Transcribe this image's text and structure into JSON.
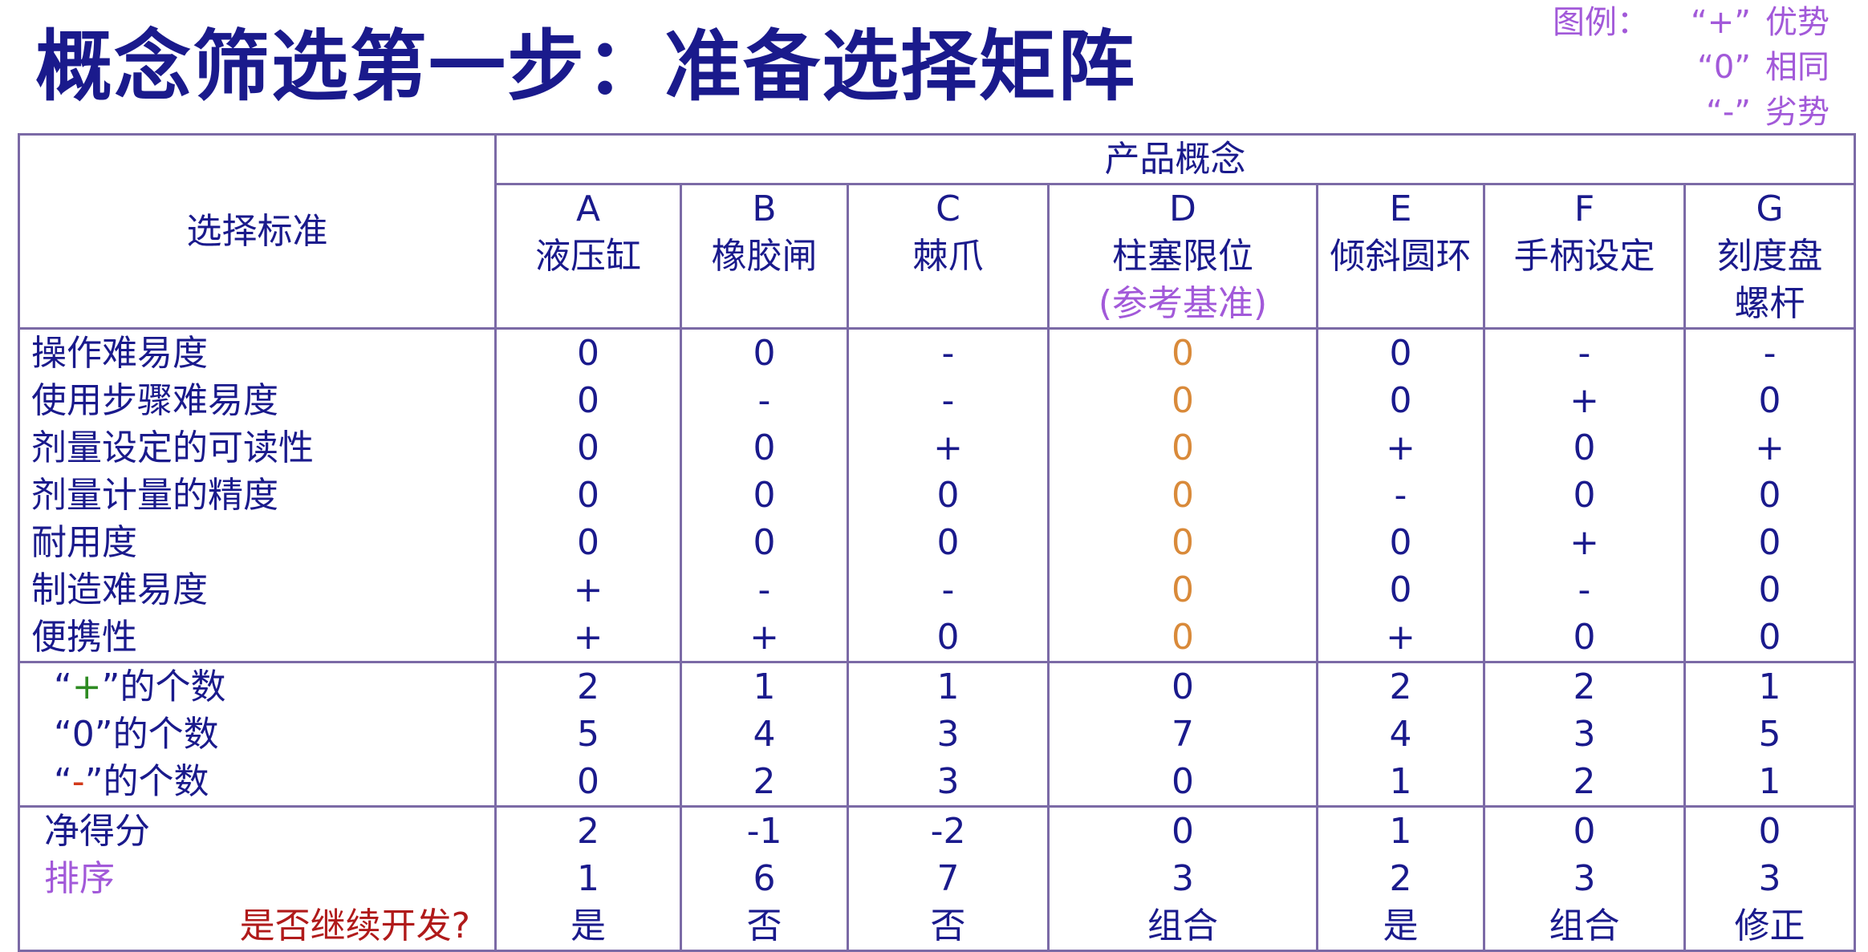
{
  "title": "概念筛选第一步：准备选择矩阵",
  "legend": {
    "label": "图例：",
    "items": [
      {
        "symbol": "“+”",
        "text": "优势"
      },
      {
        "symbol": "“0”",
        "text": "相同"
      },
      {
        "symbol": "“-”",
        "text": "劣势"
      }
    ]
  },
  "colors": {
    "title": "#1a1a8c",
    "border": "#7b6aa6",
    "plus": "#2e8b22",
    "minus": "#d23a1a",
    "reference": "#d98a3a",
    "purple": "#a259d9",
    "red": "#b01a1a"
  },
  "matrix": {
    "criteria_header": "选择标准",
    "group_header": "产品概念",
    "concepts": [
      {
        "letter": "A",
        "name": "液压缸",
        "name2": "",
        "note": ""
      },
      {
        "letter": "B",
        "name": "橡胶闸",
        "name2": "",
        "note": ""
      },
      {
        "letter": "C",
        "name": "棘爪",
        "name2": "",
        "note": ""
      },
      {
        "letter": "D",
        "name": "柱塞限位",
        "name2": "",
        "note": "(参考基准)"
      },
      {
        "letter": "E",
        "name": "倾斜圆环",
        "name2": "",
        "note": ""
      },
      {
        "letter": "F",
        "name": "手柄设定",
        "name2": "",
        "note": ""
      },
      {
        "letter": "G",
        "name": "刻度盘",
        "name2": "螺杆",
        "note": ""
      }
    ],
    "criteria": [
      {
        "name": "操作难易度",
        "values": [
          "0",
          "0",
          "-",
          "0",
          "0",
          "-",
          "-"
        ]
      },
      {
        "name": "使用步骤难易度",
        "values": [
          "0",
          "-",
          "-",
          "0",
          "0",
          "+",
          "0"
        ]
      },
      {
        "name": "剂量设定的可读性",
        "values": [
          "0",
          "0",
          "+",
          "0",
          "+",
          "0",
          "+"
        ]
      },
      {
        "name": "剂量计量的精度",
        "values": [
          "0",
          "0",
          "0",
          "0",
          "-",
          "0",
          "0"
        ]
      },
      {
        "name": "耐用度",
        "values": [
          "0",
          "0",
          "0",
          "0",
          "0",
          "+",
          "0"
        ]
      },
      {
        "name": "制造难易度",
        "values": [
          "+",
          "-",
          "-",
          "0",
          "0",
          "-",
          "0"
        ]
      },
      {
        "name": "便携性",
        "values": [
          "+",
          "+",
          "0",
          "0",
          "+",
          "0",
          "0"
        ]
      }
    ],
    "counts": [
      {
        "open": "“",
        "sym": "+",
        "close": "”",
        "suffix": "的个数",
        "values": [
          "2",
          "1",
          "1",
          "0",
          "2",
          "2",
          "1"
        ]
      },
      {
        "open": "“",
        "sym": "0",
        "close": "”",
        "suffix": "的个数",
        "values": [
          "5",
          "4",
          "3",
          "7",
          "4",
          "3",
          "5"
        ]
      },
      {
        "open": "“",
        "sym": "-",
        "close": "”",
        "suffix": "的个数",
        "values": [
          "0",
          "2",
          "3",
          "0",
          "1",
          "2",
          "1"
        ]
      }
    ],
    "net_score": {
      "label": "净得分",
      "values": [
        "2",
        "-1",
        "-2",
        "0",
        "1",
        "0",
        "0"
      ]
    },
    "rank": {
      "label": "排序",
      "values": [
        "1",
        "6",
        "7",
        "3",
        "2",
        "3",
        "3"
      ]
    },
    "continue": {
      "label": "是否继续开发?",
      "values": [
        "是",
        "否",
        "否",
        "组合",
        "是",
        "组合",
        "修正"
      ]
    }
  }
}
